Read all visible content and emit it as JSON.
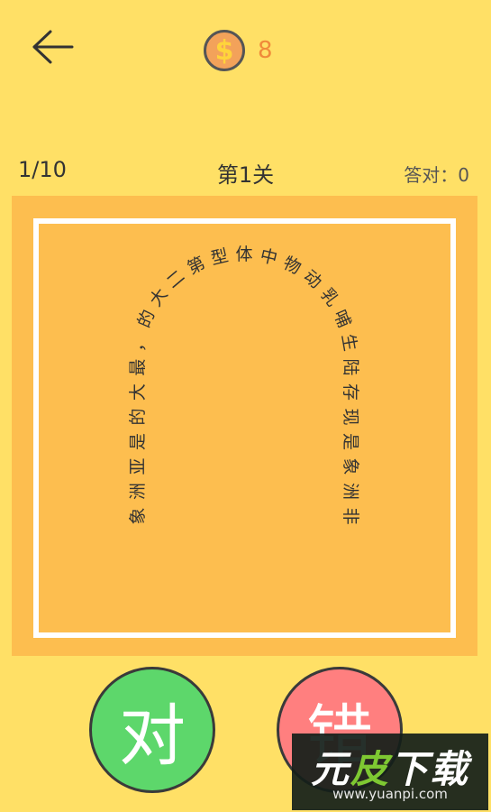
{
  "header": {
    "back_icon": "arrow-left-icon",
    "coin_symbol": "$",
    "coin_icon": "coin-icon",
    "coin_count": "8"
  },
  "status": {
    "progress": "1/10",
    "level_title": "第1关",
    "correct_label": "答对：0"
  },
  "puzzle": {
    "arch_text": "象洲亚是的大最，的大二第型体中物动乳哺生陆存现是象洲非",
    "text_color": "#333333",
    "board_color": "#FDBE4F",
    "frame_color": "#FFFFFF"
  },
  "buttons": {
    "right_label": "对",
    "wrong_label": "错",
    "right_color": "#5DD76B",
    "wrong_color": "#FF7F7F"
  },
  "watermark": {
    "title_a": "元",
    "title_b": "皮",
    "title_c": "下载",
    "url": "www.yuanpi.com"
  },
  "background_color": "#FFE066"
}
